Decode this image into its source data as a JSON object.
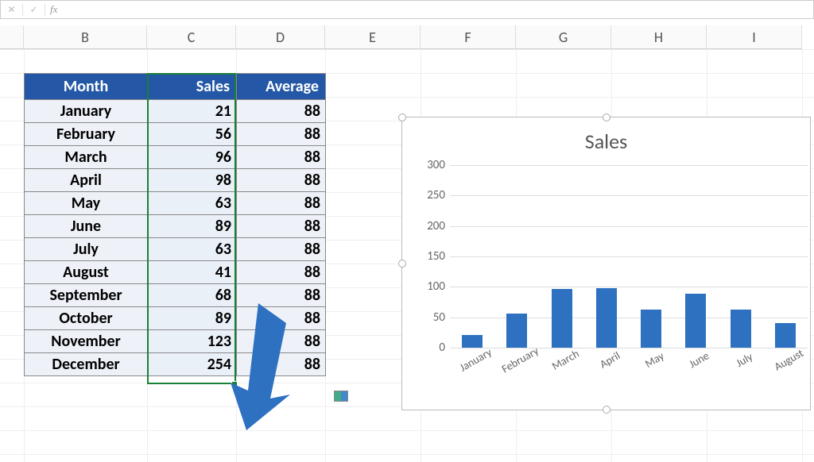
{
  "formula_bar": {
    "cancel": "✕",
    "confirm": "✓",
    "fx": "fx",
    "value": ""
  },
  "columns": [
    "B",
    "C",
    "D",
    "E",
    "F",
    "G",
    "H",
    "I"
  ],
  "table": {
    "headers": [
      "Month",
      "Sales",
      "Average"
    ],
    "rows": [
      {
        "month": "January",
        "sales": "21",
        "avg": "88"
      },
      {
        "month": "February",
        "sales": "56",
        "avg": "88"
      },
      {
        "month": "March",
        "sales": "96",
        "avg": "88"
      },
      {
        "month": "April",
        "sales": "98",
        "avg": "88"
      },
      {
        "month": "May",
        "sales": "63",
        "avg": "88"
      },
      {
        "month": "June",
        "sales": "89",
        "avg": "88"
      },
      {
        "month": "July",
        "sales": "63",
        "avg": "88"
      },
      {
        "month": "August",
        "sales": "41",
        "avg": "88"
      },
      {
        "month": "September",
        "sales": "68",
        "avg": "88"
      },
      {
        "month": "October",
        "sales": "89",
        "avg": "88"
      },
      {
        "month": "November",
        "sales": "123",
        "avg": "88"
      },
      {
        "month": "December",
        "sales": "254",
        "avg": "88"
      }
    ]
  },
  "chart": {
    "title": "Sales",
    "y_ticks": [
      "0",
      "50",
      "100",
      "150",
      "200",
      "250",
      "300"
    ]
  },
  "chart_data": {
    "type": "bar",
    "title": "Sales",
    "xlabel": "",
    "ylabel": "",
    "ylim": [
      0,
      300
    ],
    "categories": [
      "January",
      "February",
      "March",
      "April",
      "May",
      "June",
      "July",
      "August"
    ],
    "values": [
      21,
      56,
      96,
      98,
      63,
      89,
      63,
      41
    ],
    "colors": {
      "bar": "#2d71c0"
    }
  }
}
